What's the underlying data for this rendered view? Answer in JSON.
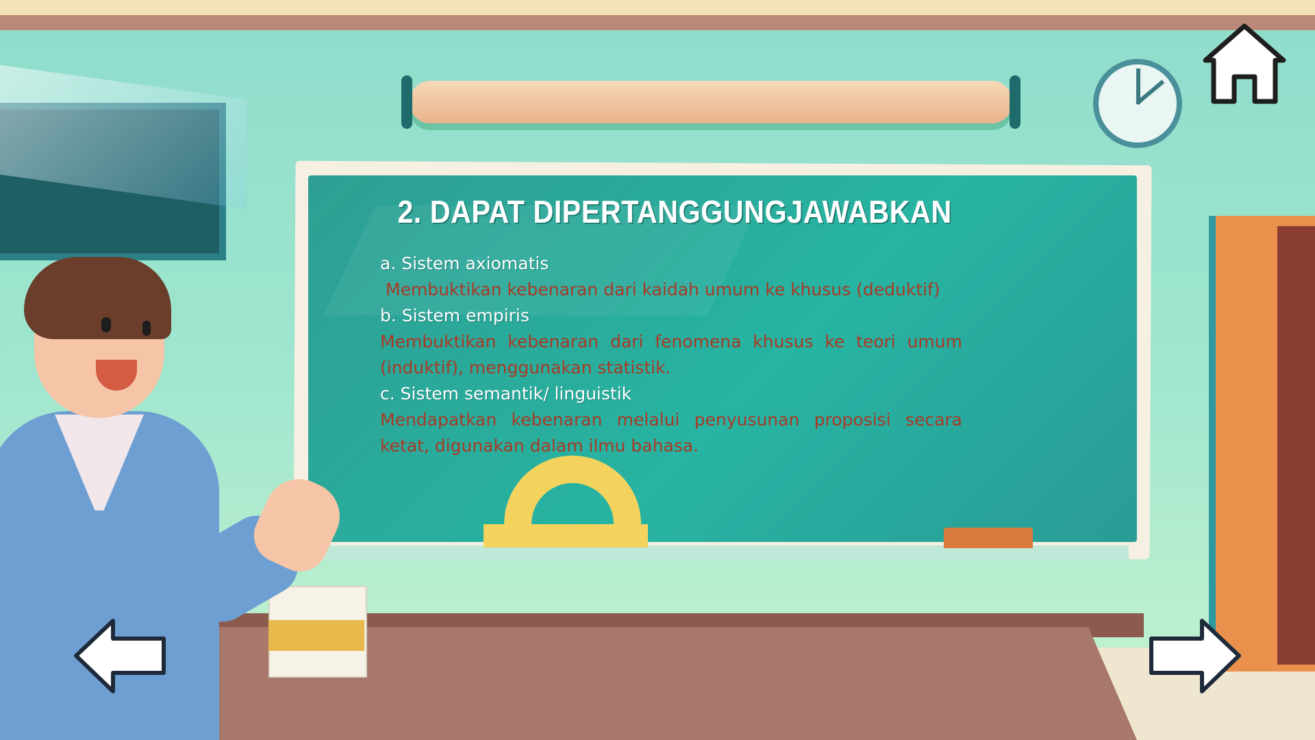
{
  "slide": {
    "title": "2. DAPAT DIPERTANGGUNGJAWABKAN",
    "items": [
      {
        "heading": "a. Sistem axiomatis",
        "body": "Membuktikan kebenaran dari kaidah umum ke khusus (deduktif)"
      },
      {
        "heading": "b. Sistem empiris",
        "body": "Membuktikan kebenaran dari fenomena khusus ke teori umum (induktif), menggunakan statistik."
      },
      {
        "heading": "c. Sistem semantik/ linguistik",
        "body": "Mendapatkan kebenaran melalui penyusunan proposisi secara ketat, digunakan dalam ilmu bahasa."
      }
    ]
  },
  "nav": {
    "home_icon": "home-icon",
    "prev_icon": "arrow-left-icon",
    "next_icon": "arrow-right-icon"
  },
  "colors": {
    "board": "#27b4a2",
    "heading_text": "#ffffff",
    "body_text": "#a83a26"
  }
}
